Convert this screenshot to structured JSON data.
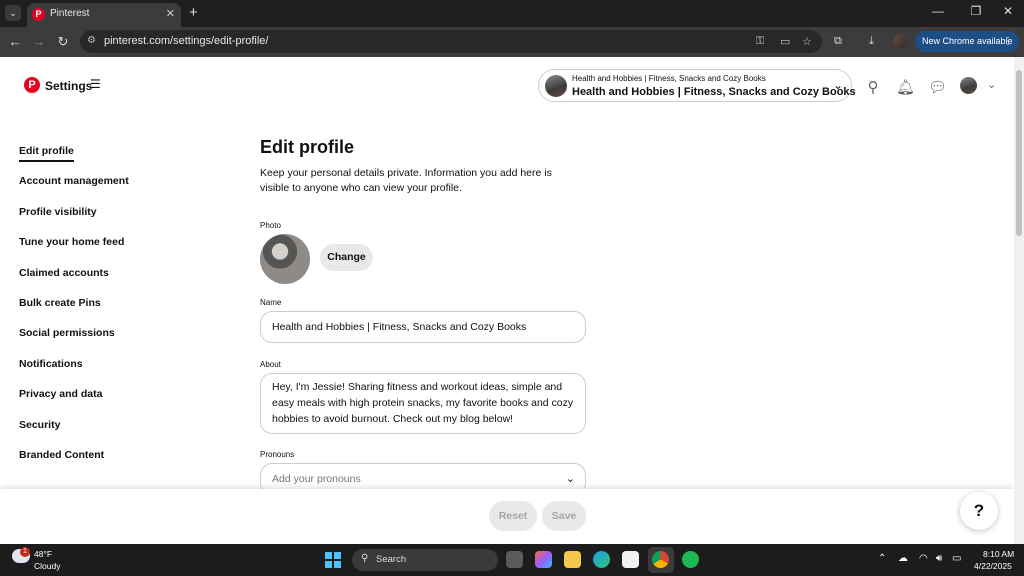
{
  "browser": {
    "tab_title": "Pinterest",
    "url": "pinterest.com/settings/edit-profile/",
    "update_button": "New Chrome available",
    "icons": [
      "tab-search-icon",
      "close-icon",
      "plus-icon",
      "back-icon",
      "forward-icon",
      "reload-icon",
      "key-icon",
      "cast-icon",
      "star-icon",
      "extensions-icon",
      "download-icon",
      "more-icon"
    ]
  },
  "header": {
    "settings_label": "Settings",
    "account_small": "Health and Hobbies | Fitness, Snacks and Cozy Books",
    "account_name": "Health and Hobbies | Fitness, Snacks and Cozy Books"
  },
  "sidebar": {
    "items": [
      {
        "label": "Edit profile",
        "active": true
      },
      {
        "label": "Account management"
      },
      {
        "label": "Profile visibility"
      },
      {
        "label": "Tune your home feed"
      },
      {
        "label": "Claimed accounts"
      },
      {
        "label": "Bulk create Pins"
      },
      {
        "label": "Social permissions"
      },
      {
        "label": "Notifications"
      },
      {
        "label": "Privacy and data"
      },
      {
        "label": "Security"
      },
      {
        "label": "Branded Content"
      }
    ]
  },
  "main": {
    "title": "Edit profile",
    "description": "Keep your personal details private. Information you add here is visible to anyone who can view your profile.",
    "photo_label": "Photo",
    "change_button": "Change",
    "name_label": "Name",
    "name_value": "Health and Hobbies | Fitness, Snacks and Cozy Books",
    "about_label": "About",
    "about_value": "Hey, I'm Jessie! Sharing fitness and workout ideas, simple and easy meals with high protein snacks, my favorite books and cozy hobbies to avoid burnout. Check out my blog below!",
    "pronouns_label": "Pronouns",
    "pronouns_placeholder": "Add your pronouns"
  },
  "footer": {
    "reset_button": "Reset",
    "save_button": "Save",
    "help_button": "?"
  },
  "taskbar": {
    "weather_badge": "1",
    "temperature": "48°F",
    "condition": "Cloudy",
    "search_label": "Search",
    "time": "8:10 AM",
    "date": "4/22/2025"
  },
  "colors": {
    "pinterest_red": "#e60023",
    "chrome_dark": "#3c3c3c",
    "update_blue": "#1d4f86"
  }
}
